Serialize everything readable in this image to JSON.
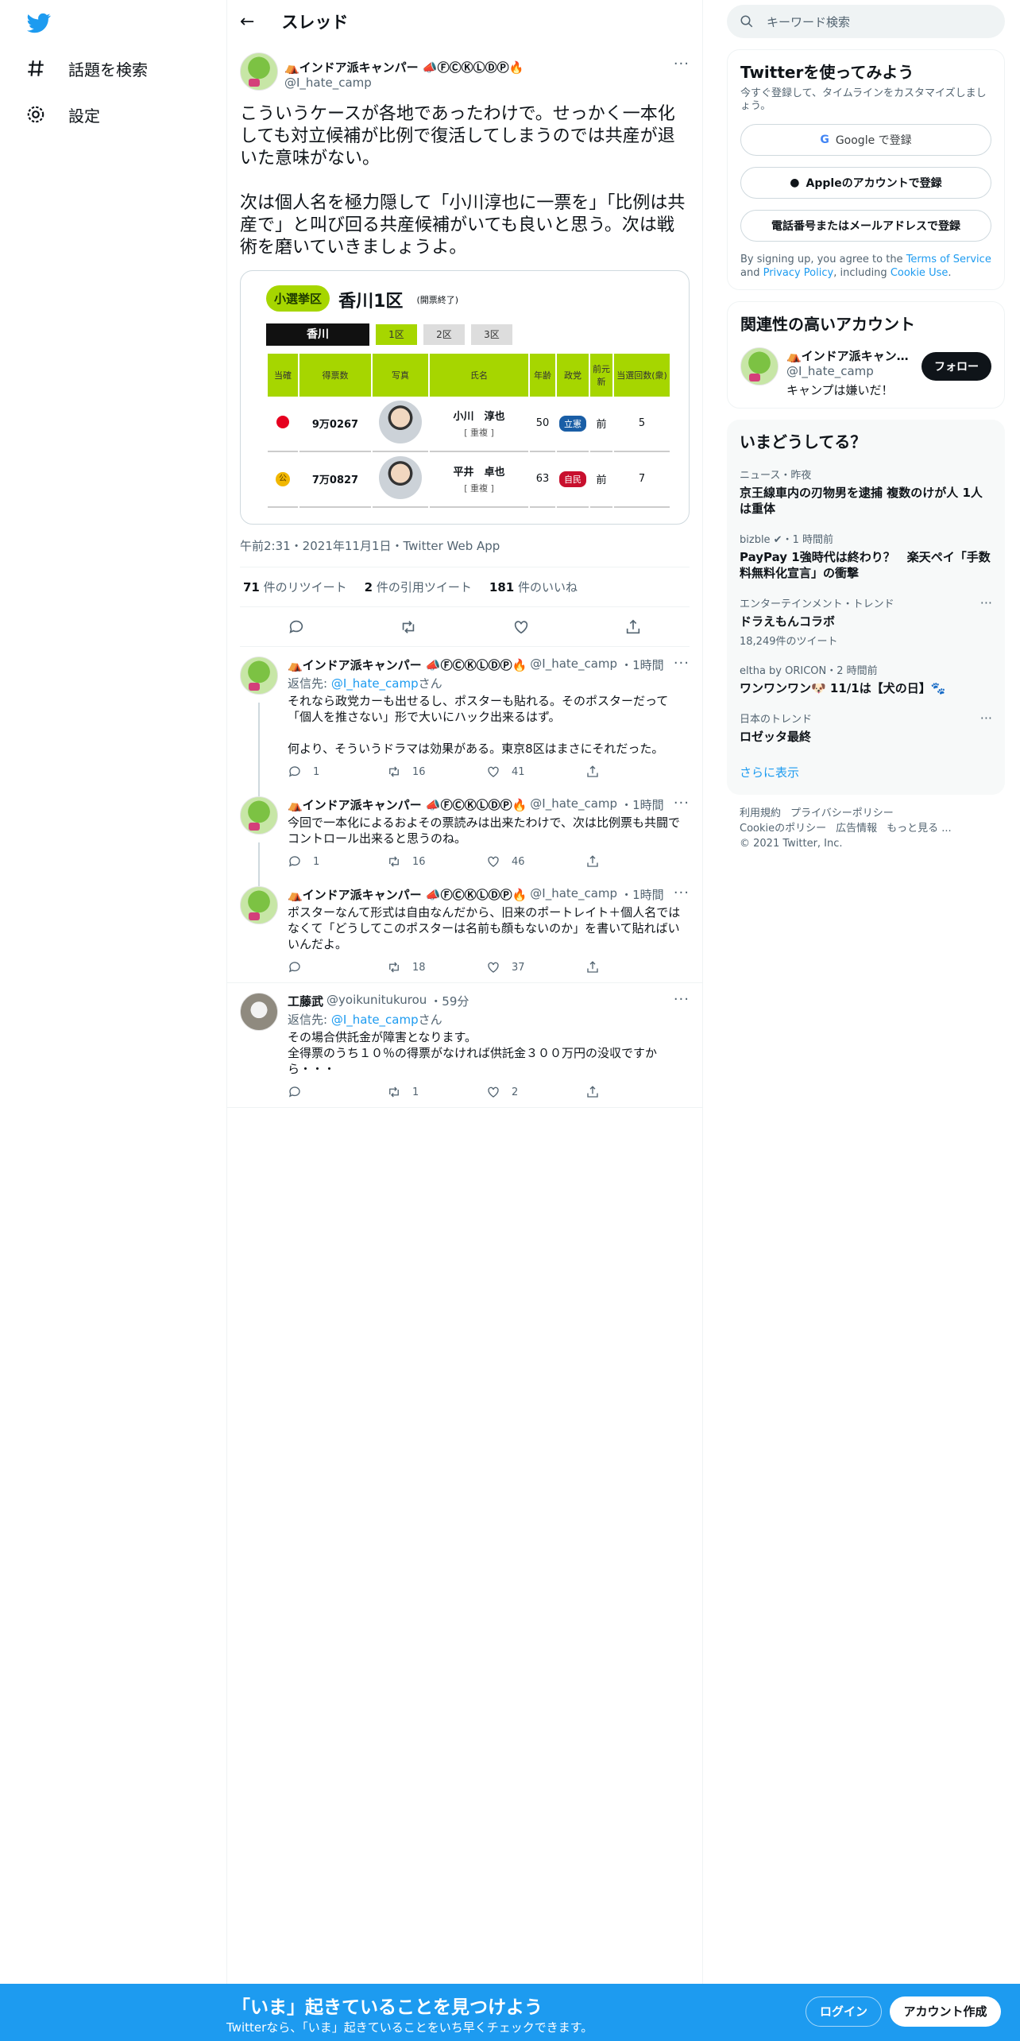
{
  "nav": {
    "explore": "話題を検索",
    "settings": "設定"
  },
  "header": {
    "title": "スレッド"
  },
  "focused": {
    "display_name": "⛺インドア派キャンパー 📣ⒻⒸⓀⓁⒹⓅ🔥",
    "handle": "@I_hate_camp",
    "text": "こういうケースが各地であったわけで。せっかく一本化しても対立候補が比例で復活してしまうのでは共産が退いた意味がない。\n\n次は個人名を極力隠して「小川淳也に一票を」「比例は共産で」と叫び回る共産候補がいても良いと思う。次は戦術を磨いていきましょうよ。",
    "card": {
      "pill": "小選挙区",
      "district": "香川1区",
      "status": "(開票終了)",
      "prefecture": "香川",
      "tabs": [
        "1区",
        "2区",
        "3区"
      ],
      "columns": [
        "当確",
        "得票数",
        "写真",
        "氏名",
        "年齢",
        "政党",
        "前元新",
        "当選回数(衆)"
      ],
      "rows": [
        {
          "mark": "rose",
          "votes": "9万0267",
          "name": "小川　淳也",
          "tag": "[ 重複 ]",
          "age": "50",
          "party": "立憲",
          "party_color": "#1a5ea6",
          "status": "前",
          "wins": "5"
        },
        {
          "mark": "gold",
          "mark_text": "公",
          "votes": "7万0827",
          "name": "平井　卓也",
          "tag": "[ 重複 ]",
          "age": "63",
          "party": "自民",
          "party_color": "#c8102e",
          "status": "前",
          "wins": "7"
        }
      ]
    },
    "meta": "午前2:31・2021年11月1日・Twitter Web App",
    "retweets_n": "71",
    "retweets_l": "件のリツイート",
    "quotes_n": "2",
    "quotes_l": "件の引用ツイート",
    "likes_n": "181",
    "likes_l": "件のいいね"
  },
  "replies": [
    {
      "display_name": "⛺インドア派キャンパー 📣ⒻⒸⓀⓁⒹⓅ🔥",
      "handle": "@I_hate_camp",
      "time": "・1時間",
      "replyto_label": "返信先: ",
      "replyto_handle": "@I_hate_camp",
      "replyto_suffix": "さん",
      "text": "それなら政党カーも出せるし、ポスターも貼れる。そのポスターだって「個人を推さない」形で大いにハック出来るはず。\n\n何より、そういうドラマは効果がある。東京8区はまさにそれだった。",
      "replies": "1",
      "retweets": "16",
      "likes": "41"
    },
    {
      "display_name": "⛺インドア派キャンパー 📣ⒻⒸⓀⓁⒹⓅ🔥",
      "handle": "@I_hate_camp",
      "time": "・1時間",
      "text": "今回で一本化によるおよその票読みは出来たわけで、次は比例票も共闘でコントロール出来ると思うのね。",
      "replies": "1",
      "retweets": "16",
      "likes": "46"
    },
    {
      "display_name": "⛺インドア派キャンパー 📣ⒻⒸⓀⓁⒹⓅ🔥",
      "handle": "@I_hate_camp",
      "time": "・1時間",
      "text": "ポスターなんて形式は自由なんだから、旧来のポートレイト＋個人名ではなくて「どうしてこのポスターは名前も顔もないのか」を書いて貼ればいいんだよ。",
      "replies": "",
      "retweets": "18",
      "likes": "37"
    },
    {
      "display_name": "工藤武",
      "handle": "@yoikunitukurou",
      "time": "・59分",
      "replyto_label": "返信先: ",
      "replyto_handle": "@I_hate_camp",
      "replyto_suffix": "さん",
      "text": "その場合供託金が障害となります。\n全得票のうち１０％の得票がなければ供託金３００万円の没収ですから・・・",
      "replies": "",
      "retweets": "1",
      "likes": "2"
    }
  ],
  "sidebar": {
    "search_placeholder": "キーワード検索",
    "signup": {
      "title": "Twitterを使ってみよう",
      "sub": "今すぐ登録して、タイムラインをカスタマイズしましょう。",
      "google": "Google で登録",
      "apple": "Appleのアカウントで登録",
      "phone": "電話番号またはメールアドレスで登録",
      "legal_pre": "By signing up, you agree to the ",
      "tos": "Terms of Service",
      "and": " and ",
      "privacy": "Privacy Policy",
      "including": ", including ",
      "cookie": "Cookie Use",
      "period": "."
    },
    "related": {
      "title": "関連性の高いアカウント",
      "name": "⛺インドア派キャン…",
      "handle": "@I_hate_camp",
      "bio": "キャンプは嫌いだ！",
      "follow": "フォロー"
    },
    "trends": {
      "title": "いまどうしてる？",
      "items": [
        {
          "cat": "ニュース・昨夜",
          "title": "京王線車内の刃物男を逮捕 複数のけが人 1人は重体"
        },
        {
          "cat": "bizble ✔・1 時間前",
          "title": "PayPay 1強時代は終わり？　楽天ペイ「手数料無料化宣言」の衝撃"
        },
        {
          "cat": "エンターテインメント・トレンド",
          "title": "ドラえもんコラボ",
          "count": "18,249件のツイート"
        },
        {
          "cat": "eltha by ORICON・2 時間前",
          "title": "ワンワンワン🐶 11/1は【犬の日】🐾"
        },
        {
          "cat": "日本のトレンド",
          "title": "ロゼッタ最終"
        }
      ],
      "more": "さらに表示"
    },
    "footer": {
      "terms": "利用規約",
      "privacy": "プライバシーポリシー",
      "cookie": "Cookieのポリシー",
      "ads": "広告情報",
      "more": "もっと見る ...",
      "copy": "© 2021 Twitter, Inc."
    }
  },
  "bottom": {
    "title": "「いま」起きていることを見つけよう",
    "sub": "Twitterなら、「いま」起きていることをいち早くチェックできます。",
    "login": "ログイン",
    "signup": "アカウント作成"
  }
}
